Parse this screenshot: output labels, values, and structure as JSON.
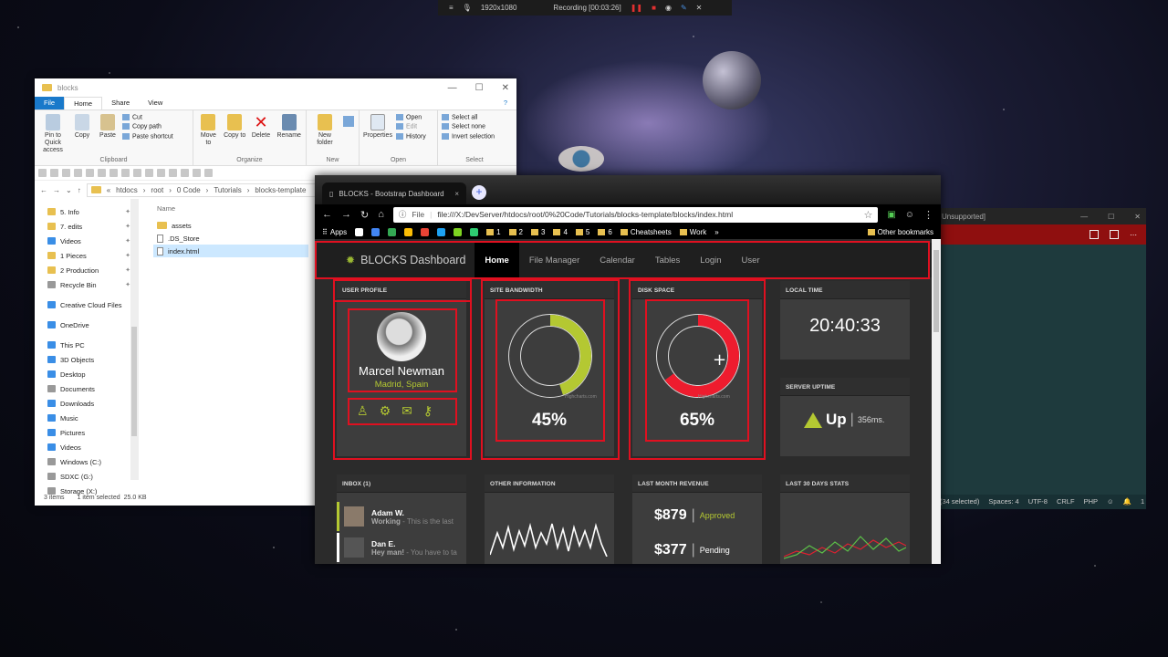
{
  "recording_bar": {
    "resolution": "1920x1080",
    "status": "Recording [00:03:26]"
  },
  "explorer": {
    "title": "blocks",
    "tabs": [
      "File",
      "Home",
      "Share",
      "View"
    ],
    "ribbon": {
      "clipboard": {
        "pin": "Pin to Quick access",
        "copy": "Copy",
        "paste": "Paste",
        "cut": "Cut",
        "copy_path": "Copy path",
        "paste_shortcut": "Paste shortcut",
        "group": "Clipboard"
      },
      "organize": {
        "move_to": "Move to",
        "copy_to": "Copy to",
        "delete": "Delete",
        "rename": "Rename",
        "group": "Organize"
      },
      "new": {
        "new_folder": "New folder",
        "group": "New"
      },
      "open": {
        "properties": "Properties",
        "open": "Open",
        "edit": "Edit",
        "history": "History",
        "group": "Open"
      },
      "select": {
        "select_all": "Select all",
        "select_none": "Select none",
        "invert": "Invert selection",
        "group": "Select"
      }
    },
    "path": [
      "«",
      "htdocs",
      "root",
      "0 Code",
      "Tutorials",
      "blocks-template"
    ],
    "nav": [
      "5. Info",
      "7. edits",
      "Videos",
      "1 Pieces",
      "2 Production",
      "Recycle Bin",
      "Creative Cloud Files",
      "OneDrive",
      "This PC",
      "3D Objects",
      "Desktop",
      "Documents",
      "Downloads",
      "Music",
      "Pictures",
      "Videos",
      "Windows (C:)",
      "SDXC (G:)",
      "Storage (X:)"
    ],
    "column_header": "Name",
    "files": [
      "assets",
      ".DS_Store",
      "index.html"
    ],
    "status": {
      "count": "3 items",
      "selected": "1 item selected",
      "size": "25.0 KB"
    }
  },
  "editor": {
    "title": "Unsupported]",
    "status": {
      "selection": "(34 selected)",
      "spaces": "Spaces: 4",
      "enc": "UTF-8",
      "eol": "CRLF",
      "lang": "PHP",
      "notif": "1"
    }
  },
  "browser": {
    "tab_title": "BLOCKS - Bootstrap Dashboard",
    "tab_close": "×",
    "new_tab": "+",
    "url_label": "File",
    "url": "file:///X:/DevServer/htdocs/root/0%20Code/Tutorials/blocks-template/blocks/index.html",
    "bookmarks": [
      "Apps",
      "1",
      "2",
      "3",
      "4",
      "5",
      "6",
      "Cheatsheets",
      "Work"
    ],
    "more": "»",
    "other_bookmarks": "Other bookmarks"
  },
  "dashboard": {
    "brand": "BLOCKS Dashboard",
    "nav": [
      "Home",
      "File Manager",
      "Calendar",
      "Tables",
      "Login",
      "User"
    ],
    "profile": {
      "header": "USER PROFILE",
      "name": "Marcel Newman",
      "location": "Madrid, Spain"
    },
    "bandwidth": {
      "header": "SITE BANDWIDTH",
      "value": 45,
      "label": "45%",
      "color": "#b4c832",
      "credit": "Highcharts.com"
    },
    "disk": {
      "header": "DISK SPACE",
      "value": 65,
      "label": "65%",
      "color": "#ee1c2e",
      "credit": "Highcharts.com"
    },
    "local_time": {
      "header": "LOCAL TIME",
      "value": "20:40:33"
    },
    "uptime": {
      "header": "SERVER UPTIME",
      "status": "Up",
      "ms": "356ms."
    },
    "inbox": {
      "header": "INBOX (1)",
      "messages": [
        {
          "name": "Adam W.",
          "preview_bold": "Working",
          "preview": "- This is the last",
          "color": "#b4c832"
        },
        {
          "name": "Dan E.",
          "preview_bold": "Hey man!",
          "preview": "- You have to ta",
          "color": "#ffffff"
        }
      ]
    },
    "other_info": {
      "header": "OTHER INFORMATION"
    },
    "revenue": {
      "header": "LAST MONTH REVENUE",
      "rows": [
        {
          "amount": "$879",
          "status": "Approved",
          "color": "#b4c832"
        },
        {
          "amount": "$377",
          "status": "Pending",
          "color": "#ffffff"
        }
      ]
    },
    "stats": {
      "header": "LAST 30 DAYS STATS"
    }
  }
}
